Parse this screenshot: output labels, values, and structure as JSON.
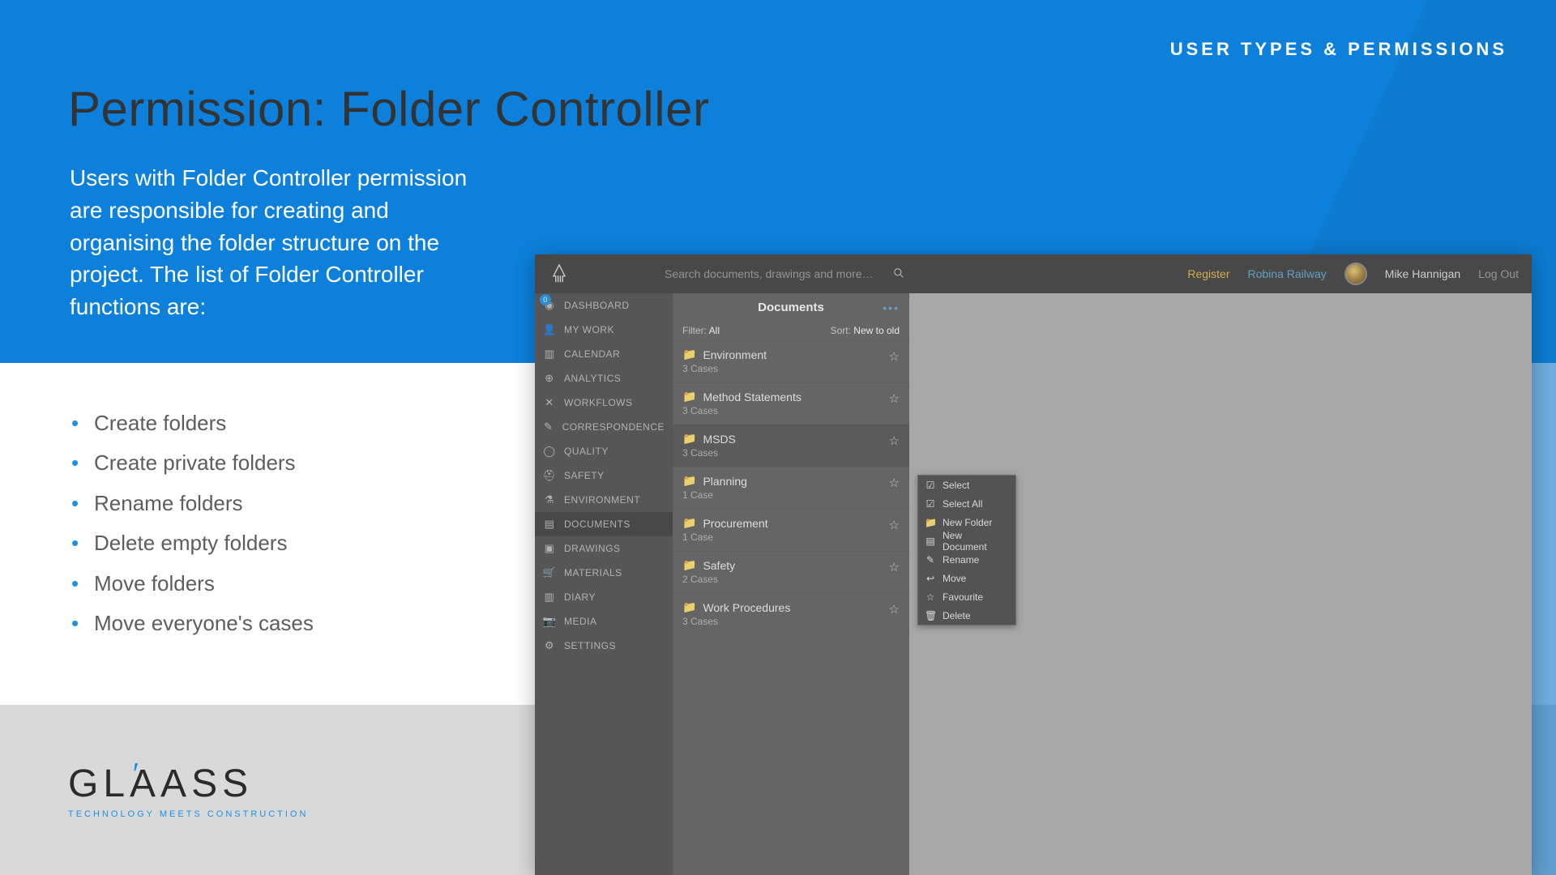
{
  "slide": {
    "crumb": "USER TYPES & PERMISSIONS",
    "title": "Permission: Folder Controller",
    "intro": "Users with Folder Controller permission are responsible for creating and organising the folder structure on the project. The list of Folder Controller functions are:",
    "bullets": [
      "Create folders",
      "Create private folders",
      "Rename folders",
      "Delete empty folders",
      "Move folders",
      "Move everyone's cases"
    ],
    "logo": "GLASS",
    "logo_tag": "TECHNOLOGY MEETS CONSTRUCTION"
  },
  "app": {
    "search_placeholder": "Search documents, drawings and more…",
    "top": {
      "register": "Register",
      "project": "Robina Railway",
      "user": "Mike Hannigan",
      "logout": "Log Out"
    },
    "sidebar": [
      {
        "icon": "dashboard",
        "label": "DASHBOARD",
        "badge": "0"
      },
      {
        "icon": "person",
        "label": "MY WORK"
      },
      {
        "icon": "calendar",
        "label": "CALENDAR"
      },
      {
        "icon": "analytics",
        "label": "ANALYTICS"
      },
      {
        "icon": "shuffle",
        "label": "WORKFLOWS"
      },
      {
        "icon": "edit",
        "label": "CORRESPONDENCE"
      },
      {
        "icon": "quality",
        "label": "QUALITY"
      },
      {
        "icon": "safety",
        "label": "SAFETY"
      },
      {
        "icon": "flask",
        "label": "ENVIRONMENT"
      },
      {
        "icon": "doc",
        "label": "DOCUMENTS",
        "active": true
      },
      {
        "icon": "image",
        "label": "DRAWINGS"
      },
      {
        "icon": "cart",
        "label": "MATERIALS"
      },
      {
        "icon": "book",
        "label": "DIARY"
      },
      {
        "icon": "camera",
        "label": "MEDIA"
      },
      {
        "icon": "gear",
        "label": "SETTINGS"
      }
    ],
    "panel": {
      "title": "Documents",
      "dots": "•••",
      "filter_label": "Filter:",
      "filter_value": "All",
      "sort_label": "Sort:",
      "sort_value": "New to old"
    },
    "folders": [
      {
        "name": "Environment",
        "sub": "3 Cases"
      },
      {
        "name": "Method Statements",
        "sub": "3 Cases"
      },
      {
        "name": "MSDS",
        "sub": "3 Cases",
        "active": true
      },
      {
        "name": "Planning",
        "sub": "1 Case"
      },
      {
        "name": "Procurement",
        "sub": "1 Case"
      },
      {
        "name": "Safety",
        "sub": "2 Cases"
      },
      {
        "name": "Work Procedures",
        "sub": "3 Cases"
      }
    ],
    "context": [
      {
        "icon": "select",
        "label": "Select"
      },
      {
        "icon": "select",
        "label": "Select All"
      },
      {
        "icon": "folder",
        "label": "New Folder"
      },
      {
        "icon": "doc",
        "label": "New Document"
      },
      {
        "icon": "pencil",
        "label": "Rename"
      },
      {
        "icon": "undo",
        "label": "Move"
      },
      {
        "icon": "star",
        "label": "Favourite"
      },
      {
        "icon": "trash",
        "label": "Delete"
      }
    ]
  }
}
